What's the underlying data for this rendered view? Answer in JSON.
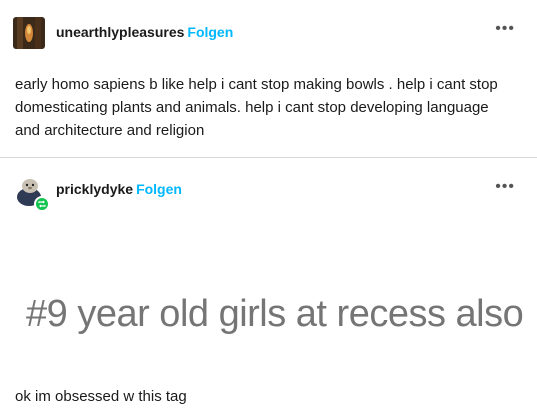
{
  "posts": [
    {
      "username": "unearthlypleasures",
      "follow_label": "Folgen",
      "more_label": "•••",
      "text": "early homo sapiens b like help i cant stop making bowls . help i cant stop domesticating plants and animals. help i cant stop developing language and architecture and religion"
    },
    {
      "username": "pricklydyke",
      "follow_label": "Folgen",
      "more_label": "•••",
      "image_text": "#9 year old girls at recess also",
      "text": "ok im obsessed w this tag"
    }
  ],
  "colors": {
    "accent": "#00b8ff",
    "reblog_badge": "#14c450"
  }
}
